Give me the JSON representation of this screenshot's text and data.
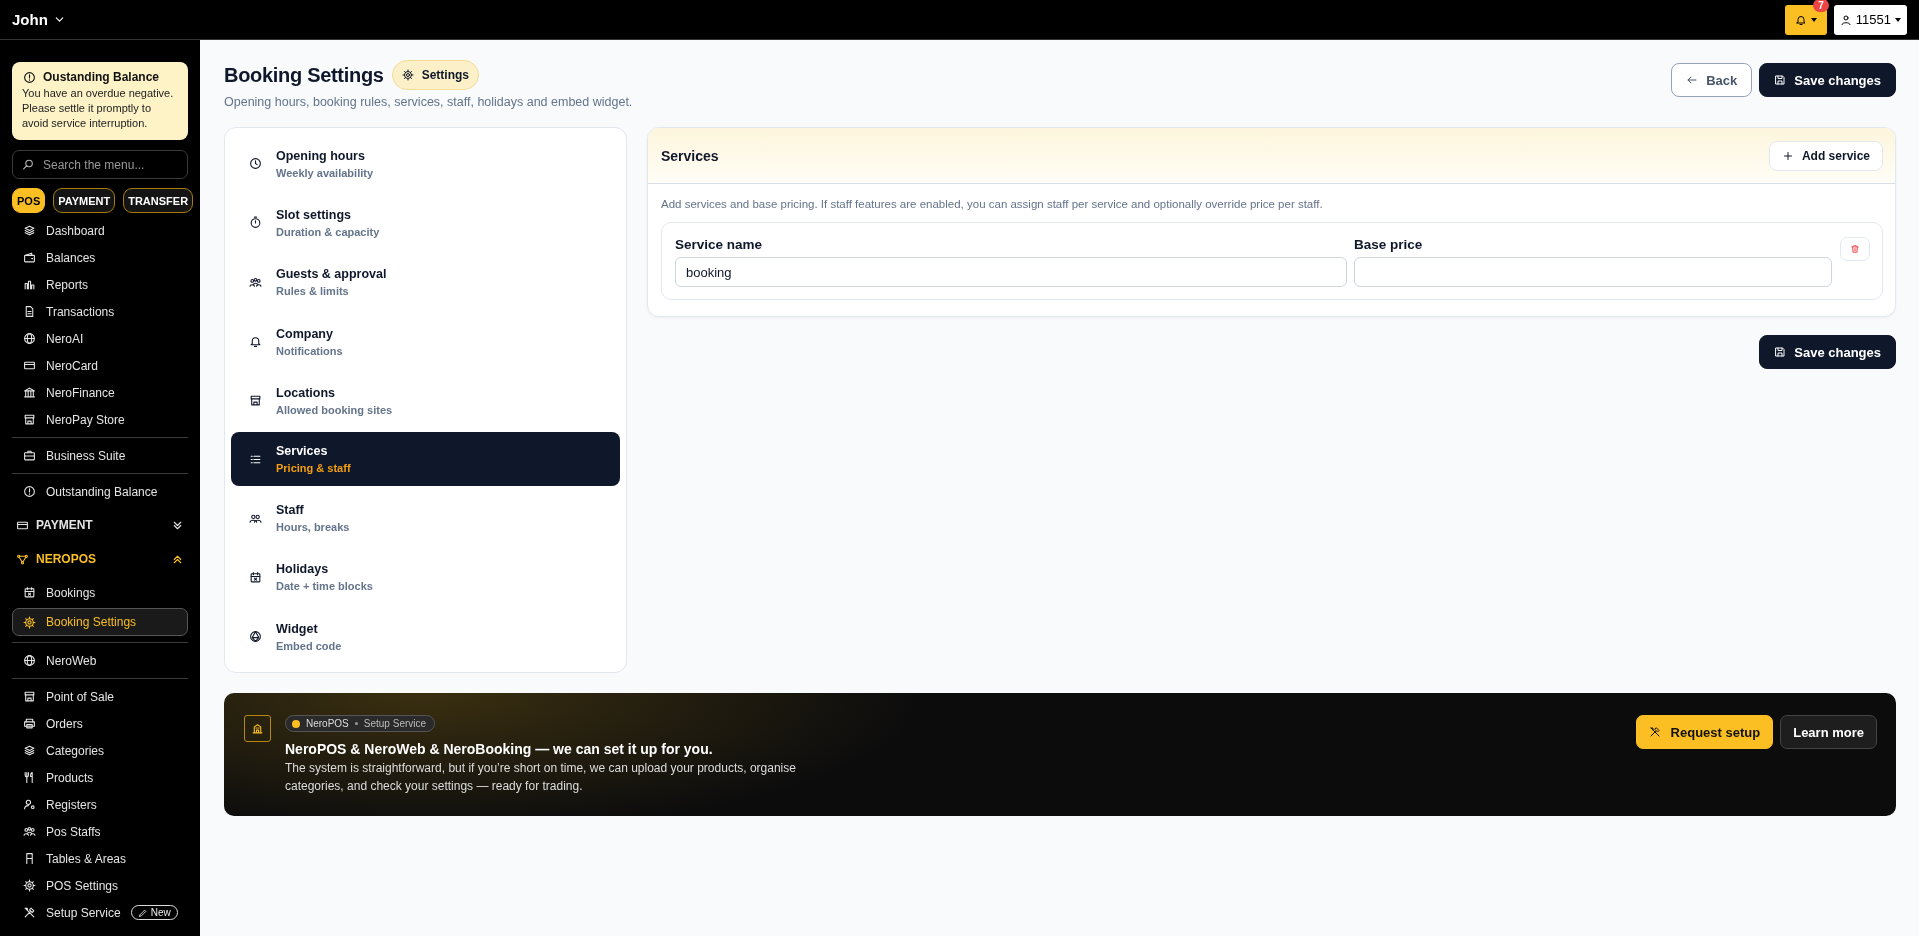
{
  "topbar": {
    "user": "John",
    "notification_count": "7",
    "account": "11551"
  },
  "sidebar": {
    "alert": {
      "title": "Oustanding Balance",
      "text": "You have an overdue negative. Please settle it promptly to avoid service interruption."
    },
    "search": {
      "placeholder": "Search the menu..."
    },
    "pills": [
      {
        "label": "POS",
        "selected": true
      },
      {
        "label": "PAYMENT",
        "selected": false
      },
      {
        "label": "TRANSFER",
        "selected": false
      }
    ],
    "blocks": [
      {
        "kind": "menu",
        "items": [
          {
            "label": "Dashboard",
            "selected": false
          },
          {
            "label": "Balances",
            "selected": false
          },
          {
            "label": "Reports",
            "selected": false
          },
          {
            "label": "Transactions",
            "selected": false
          },
          {
            "label": "NeroAI",
            "selected": false
          },
          {
            "label": "NeroCard",
            "selected": false
          },
          {
            "label": "NeroFinance",
            "selected": false
          },
          {
            "label": "NeroPay Store",
            "selected": false
          }
        ]
      },
      {
        "kind": "menu",
        "items": [
          {
            "label": "Business Suite",
            "selected": false
          }
        ]
      },
      {
        "kind": "menu",
        "items": [
          {
            "label": "Outstanding Balance",
            "selected": false
          }
        ]
      },
      {
        "kind": "section",
        "label": "PAYMENT",
        "expanded": false
      },
      {
        "kind": "section",
        "label": "NEROPOS",
        "expanded": true,
        "items": [
          {
            "label": "Bookings",
            "selected": false
          },
          {
            "label": "Booking Settings",
            "selected": true
          }
        ]
      },
      {
        "kind": "menu",
        "items": [
          {
            "label": "NeroWeb",
            "selected": false
          }
        ]
      },
      {
        "kind": "menu",
        "items": [
          {
            "label": "Point of Sale",
            "selected": false
          },
          {
            "label": "Orders",
            "selected": false
          },
          {
            "label": "Categories",
            "selected": false
          },
          {
            "label": "Products",
            "selected": false
          },
          {
            "label": "Registers",
            "selected": false
          },
          {
            "label": "Pos Staffs",
            "selected": false
          },
          {
            "label": "Tables & Areas",
            "selected": false
          },
          {
            "label": "POS Settings",
            "selected": false
          },
          {
            "label": "Setup Service",
            "selected": false,
            "badge": "New"
          }
        ]
      }
    ]
  },
  "header": {
    "title": "Booking Settings",
    "badge": "Settings",
    "subtitle": "Opening hours, booking rules, services, staff, holidays and embed widget.",
    "buttons": [
      {
        "label": "Back",
        "kind": "secondary"
      },
      {
        "label": "Save changes",
        "kind": "primary"
      }
    ]
  },
  "settings_nav": [
    {
      "title": "Opening hours",
      "subtitle": "Weekly availability",
      "selected": false
    },
    {
      "title": "Slot settings",
      "subtitle": "Duration & capacity",
      "selected": false
    },
    {
      "title": "Guests & approval",
      "subtitle": "Rules & limits",
      "selected": false
    },
    {
      "title": "Company",
      "subtitle": "Notifications",
      "selected": false
    },
    {
      "title": "Locations",
      "subtitle": "Allowed booking sites",
      "selected": false
    },
    {
      "title": "Services",
      "subtitle": "Pricing & staff",
      "selected": true
    },
    {
      "title": "Staff",
      "subtitle": "Hours, breaks",
      "selected": false
    },
    {
      "title": "Holidays",
      "subtitle": "Date + time blocks",
      "selected": false
    },
    {
      "title": "Widget",
      "subtitle": "Embed code",
      "selected": false
    }
  ],
  "services_panel": {
    "title": "Services",
    "add_button": "Add service",
    "description": "Add services and base pricing. If staff features are enabled, you can assign staff per service and optionally override price per staff.",
    "services": [
      {
        "fields": [
          {
            "label": "Service name",
            "value": "booking"
          },
          {
            "label": "Base price"
          }
        ]
      }
    ],
    "save_button": "Save changes"
  },
  "banner": {
    "tag": "NeroPOS",
    "tag_detail": "Setup Service",
    "title": "NeroPOS & NeroWeb & NeroBooking — we can set it up for you.",
    "text": "The system is straightforward, but if you’re short on time, we can upload your products, organise categories, and check your settings — ready for trading.",
    "buttons": [
      {
        "label": "Request setup",
        "kind": "primary"
      },
      {
        "label": "Learn more",
        "kind": "secondary"
      }
    ]
  }
}
